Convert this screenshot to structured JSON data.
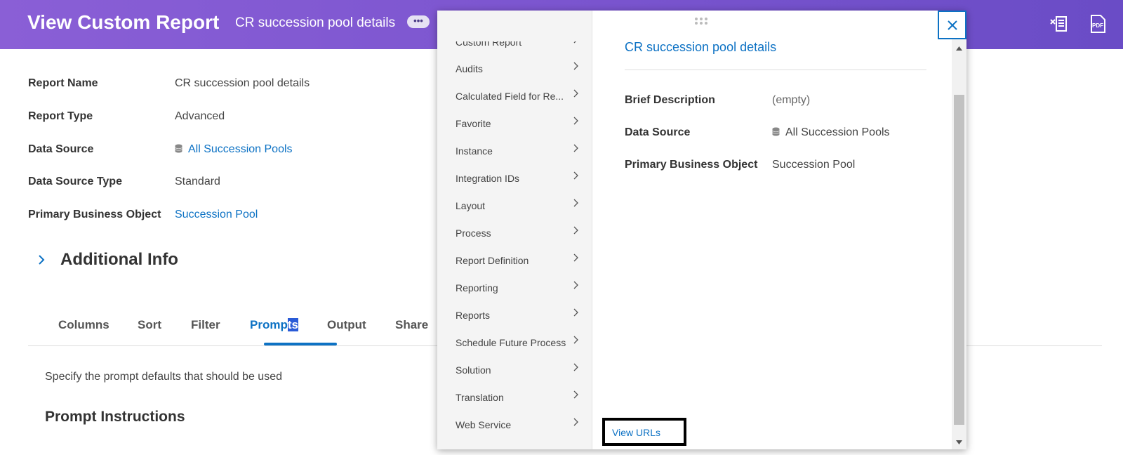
{
  "header": {
    "title": "View Custom Report",
    "subtitle": "CR succession pool details",
    "more_label": "•••",
    "excel_icon": "excel-export-icon",
    "pdf_icon": "pdf-export-icon",
    "pdf_label": "PDF",
    "background_color": "#7b55cf"
  },
  "details": {
    "fields": [
      {
        "label": "Report Name",
        "value": "CR succession pool details"
      },
      {
        "label": "Report Type",
        "value": "Advanced"
      },
      {
        "label": "Data Source",
        "value": "All Succession Pools"
      },
      {
        "label": "Data Source Type",
        "value": "Standard"
      },
      {
        "label": "Primary Business Object",
        "value": "Succession Pool"
      }
    ],
    "additional_info": "Additional Info"
  },
  "tabs": {
    "items": [
      "Columns",
      "Sort",
      "Filter",
      "Prompts",
      "Output",
      "Share"
    ],
    "active": "Prompts",
    "active_prefix": "Promp",
    "active_highlight": "ts"
  },
  "prompts": {
    "intro": "Specify the prompt defaults that should be used",
    "heading": "Prompt Instructions"
  },
  "related_actions": {
    "menu": [
      "Custom Report",
      "Audits",
      "Calculated Field for Re...",
      "Favorite",
      "Instance",
      "Integration IDs",
      "Layout",
      "Process",
      "Report Definition",
      "Reporting",
      "Reports",
      "Schedule Future Process",
      "Solution",
      "Translation",
      "Web Service"
    ],
    "submenu": [
      "View URLs"
    ],
    "panel": {
      "title": "CR succession pool details",
      "fields": [
        {
          "label": "Brief Description",
          "value": "(empty)"
        },
        {
          "label": "Data Source",
          "value": "All Succession Pools"
        },
        {
          "label": "Primary Business Object",
          "value": "Succession Pool"
        }
      ]
    },
    "close_icon": "close-icon"
  },
  "colors": {
    "link": "#0d72c4",
    "accent": "#0d72c4"
  }
}
